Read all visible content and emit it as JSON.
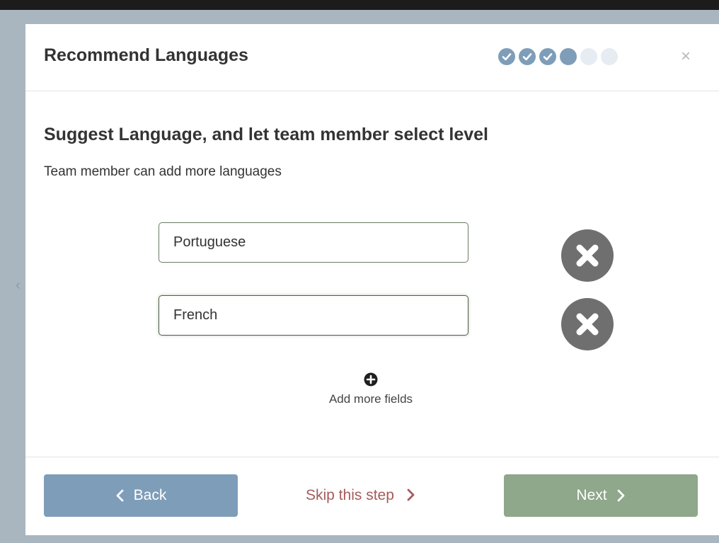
{
  "modal": {
    "title": "Recommend Languages",
    "close_icon": "close-icon",
    "steps": [
      "done",
      "done",
      "done",
      "current",
      "todo",
      "todo"
    ]
  },
  "content": {
    "heading": "Suggest Language, and let team member select level",
    "subtitle": "Team member can add more languages",
    "languages": [
      {
        "value": "Portuguese"
      },
      {
        "value": "French"
      }
    ],
    "add_more_label": "Add more fields"
  },
  "footer": {
    "back_label": "Back",
    "skip_label": "Skip this step",
    "next_label": "Next"
  },
  "colors": {
    "back_button": "#7e9db8",
    "next_button": "#8fa78a",
    "skip_text": "#a65b5b",
    "remove_button": "#6f6f6f"
  }
}
